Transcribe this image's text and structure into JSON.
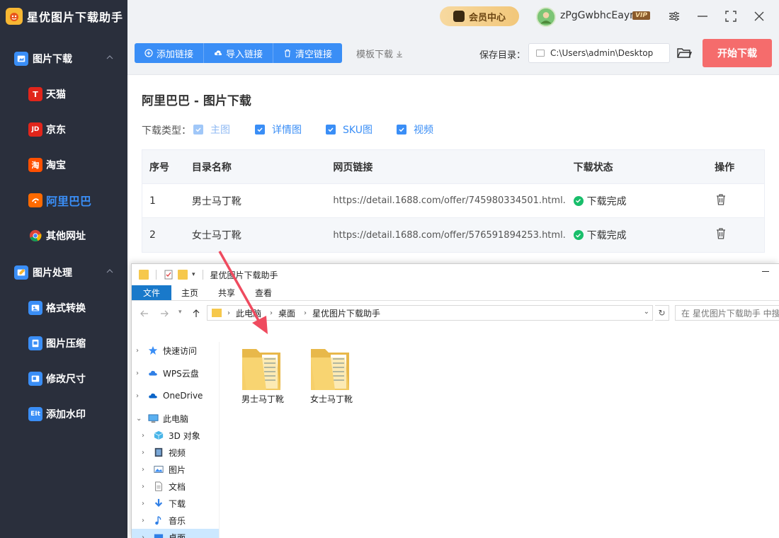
{
  "app": {
    "title": "星优图片下载助手",
    "vip_center": "会员中心",
    "username": "zPgGwbhcEayr",
    "vip_badge": "VIP"
  },
  "sidebar": {
    "groups": [
      {
        "label": "图片下载",
        "items": [
          {
            "label": "天猫",
            "icon_text": "T",
            "color": "#e1251b"
          },
          {
            "label": "京东",
            "icon_text": "JD",
            "color": "#e1251b"
          },
          {
            "label": "淘宝",
            "icon_text": "淘",
            "color": "#ff5000"
          },
          {
            "label": "阿里巴巴",
            "icon_text": "",
            "color": "#ff6a00"
          },
          {
            "label": "其他网址",
            "icon_text": "",
            "color": "#4caf50"
          }
        ]
      },
      {
        "label": "图片处理",
        "items": [
          {
            "label": "格式转换",
            "icon_text": "",
            "color": "#3a8ef6"
          },
          {
            "label": "图片压缩",
            "icon_text": "",
            "color": "#3a8ef6"
          },
          {
            "label": "修改尺寸",
            "icon_text": "",
            "color": "#3a8ef6"
          },
          {
            "label": "添加水印",
            "icon_text": "EIt",
            "color": "#3a8ef6"
          }
        ]
      }
    ],
    "active": "阿里巴巴"
  },
  "toolbar": {
    "add_link": "添加链接",
    "import_link": "导入链接",
    "clear_link": "清空链接",
    "template_download": "模板下载",
    "save_dir_label": "保存目录：",
    "save_dir_value": "C:\\Users\\admin\\Desktop",
    "start_download": "开始下载"
  },
  "main": {
    "title": "阿里巴巴 - 图片下载",
    "download_type_label": "下载类型：",
    "checkboxes": [
      {
        "label": "主图",
        "checked": true,
        "disabled": true
      },
      {
        "label": "详情图",
        "checked": true,
        "disabled": false
      },
      {
        "label": "SKU图",
        "checked": true,
        "disabled": false
      },
      {
        "label": "视频",
        "checked": true,
        "disabled": false
      }
    ],
    "table": {
      "headers": [
        "序号",
        "目录名称",
        "网页链接",
        "下载状态",
        "操作"
      ],
      "rows": [
        {
          "index": "1",
          "name": "男士马丁靴",
          "url": "https://detail.1688.com/offer/745980334501.html...",
          "status": "下载完成"
        },
        {
          "index": "2",
          "name": "女士马丁靴",
          "url": "https://detail.1688.com/offer/576591894253.html...",
          "status": "下载完成"
        }
      ]
    }
  },
  "explorer": {
    "title": "星优图片下载助手",
    "tabs": [
      "文件",
      "主页",
      "共享",
      "查看"
    ],
    "breadcrumb": [
      "此电脑",
      "桌面",
      "星优图片下载助手"
    ],
    "search_placeholder": "在 星优图片下载助手 中搜",
    "nav": [
      {
        "label": "快速访问",
        "level": 0
      },
      {
        "label": "WPS云盘",
        "level": 0
      },
      {
        "label": "OneDrive",
        "level": 0
      },
      {
        "label": "此电脑",
        "level": 0
      },
      {
        "label": "3D 对象",
        "level": 1
      },
      {
        "label": "视频",
        "level": 1
      },
      {
        "label": "图片",
        "level": 1
      },
      {
        "label": "文档",
        "level": 1
      },
      {
        "label": "下载",
        "level": 1
      },
      {
        "label": "音乐",
        "level": 1
      },
      {
        "label": "桌面",
        "level": 1
      }
    ],
    "folders": [
      "男士马丁靴",
      "女士马丁靴"
    ]
  },
  "colors": {
    "sidebar_bg": "#2a2f3c",
    "accent": "#3a8ef6",
    "start_button": "#f56c6c",
    "success": "#19be6b",
    "arrow": "#ef4b5f"
  }
}
